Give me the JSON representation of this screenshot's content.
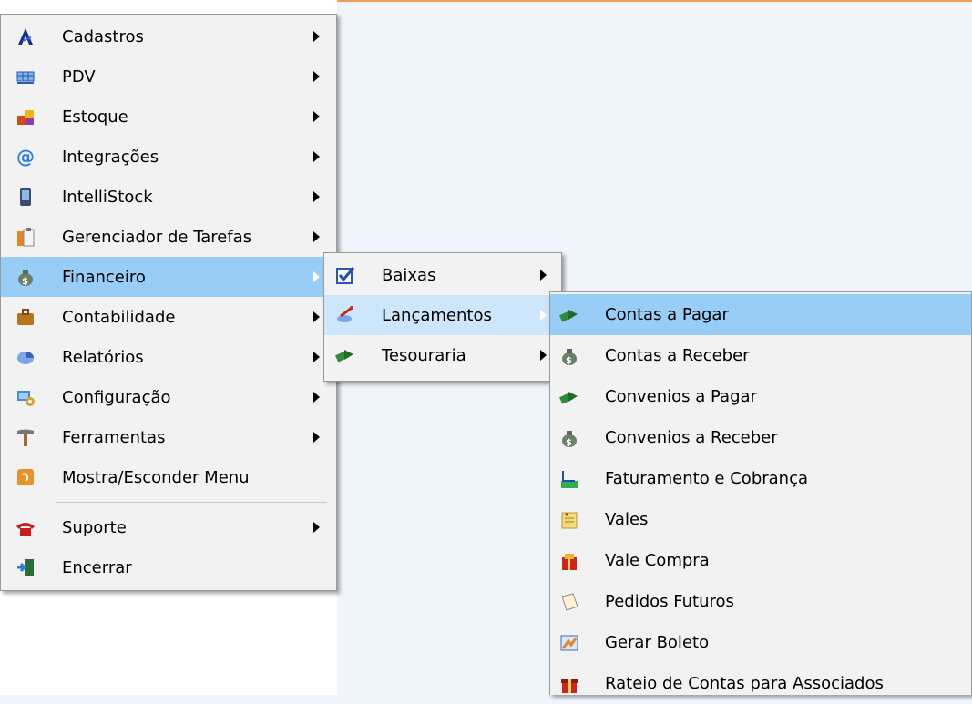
{
  "main_menu": {
    "items": [
      {
        "label": "Cadastros",
        "icon": "cadastros-icon",
        "submenu": true
      },
      {
        "label": "PDV",
        "icon": "pdv-register-icon",
        "submenu": true
      },
      {
        "label": "Estoque",
        "icon": "stock-boxes-icon",
        "submenu": true
      },
      {
        "label": "Integrações",
        "icon": "at-sign-icon",
        "submenu": true
      },
      {
        "label": "IntelliStock",
        "icon": "mobile-device-icon",
        "submenu": true
      },
      {
        "label": "Gerenciador de Tarefas",
        "icon": "clipboard-icon",
        "submenu": true
      },
      {
        "label": "Financeiro",
        "icon": "money-bag-icon",
        "submenu": true
      },
      {
        "label": "Contabilidade",
        "icon": "briefcase-icon",
        "submenu": true
      },
      {
        "label": "Relatórios",
        "icon": "pie-chart-icon",
        "submenu": true
      },
      {
        "label": "Configuração",
        "icon": "config-icon",
        "submenu": true
      },
      {
        "label": "Ferramentas",
        "icon": "hammer-icon",
        "submenu": true
      },
      {
        "label": "Mostra/Esconder Menu",
        "icon": "toggle-menu-icon",
        "submenu": false
      },
      {
        "label": "Suporte",
        "icon": "phone-icon",
        "submenu": true
      },
      {
        "label": "Encerrar",
        "icon": "exit-door-icon",
        "submenu": false
      }
    ]
  },
  "financeiro_menu": {
    "items": [
      {
        "label": "Baixas",
        "icon": "checkbox-icon"
      },
      {
        "label": "Lançamentos",
        "icon": "pen-satellite-icon"
      },
      {
        "label": "Tesouraria",
        "icon": "money-arrow-icon"
      }
    ]
  },
  "lancamentos_menu": {
    "items": [
      {
        "label": "Contas a Pagar",
        "icon": "money-arrow-icon"
      },
      {
        "label": "Contas a Receber",
        "icon": "money-bag-icon"
      },
      {
        "label": "Convenios a Pagar",
        "icon": "money-arrow-icon"
      },
      {
        "label": "Convenios a Receber",
        "icon": "money-bag-icon"
      },
      {
        "label": "Faturamento e Cobrança",
        "icon": "billing-icon"
      },
      {
        "label": "Vales",
        "icon": "note-icon"
      },
      {
        "label": "Vale Compra",
        "icon": "gift-bag-icon"
      },
      {
        "label": "Pedidos Futuros",
        "icon": "document-icon"
      },
      {
        "label": "Gerar Boleto",
        "icon": "boleto-icon"
      },
      {
        "label": "Rateio de Contas para Associados",
        "icon": "gift-box-icon"
      }
    ]
  },
  "colors": {
    "highlight": "#98cdf7",
    "highlight_parent": "#cde6fb",
    "accent_line": "#f0a050"
  }
}
